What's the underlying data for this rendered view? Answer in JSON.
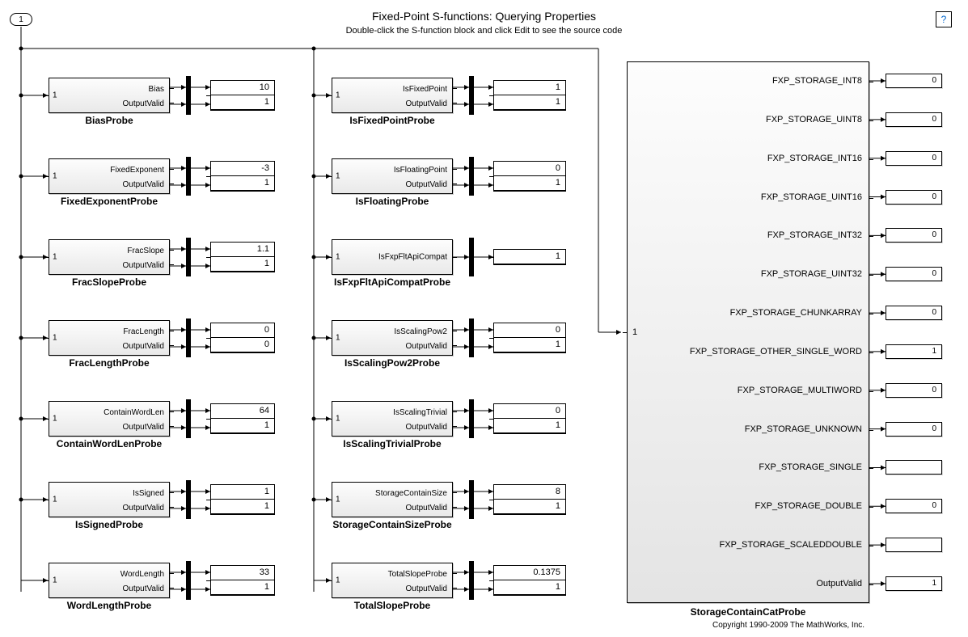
{
  "header": {
    "title": "Fixed-Point S-functions: Querying Properties",
    "subtitle": "Double-click the S-function block and click Edit to see the source code"
  },
  "inport": {
    "label": "1"
  },
  "help": {
    "label": "?"
  },
  "probes_col1": [
    {
      "name": "BiasProbe",
      "in": "1",
      "out1": "Bias",
      "out2": "OutputValid",
      "v1": "10",
      "v2": "1"
    },
    {
      "name": "FixedExponentProbe",
      "in": "1",
      "out1": "FixedExponent",
      "out2": "OutputValid",
      "v1": "-3",
      "v2": "1"
    },
    {
      "name": "FracSlopeProbe",
      "in": "1",
      "out1": "FracSlope",
      "out2": "OutputValid",
      "v1": "1.1",
      "v2": "1"
    },
    {
      "name": "FracLengthProbe",
      "in": "1",
      "out1": "FracLength",
      "out2": "OutputValid",
      "v1": "0",
      "v2": "0"
    },
    {
      "name": "ContainWordLenProbe",
      "in": "1",
      "out1": "ContainWordLen",
      "out2": "OutputValid",
      "v1": "64",
      "v2": "1"
    },
    {
      "name": "IsSignedProbe",
      "in": "1",
      "out1": "IsSigned",
      "out2": "OutputValid",
      "v1": "1",
      "v2": "1"
    },
    {
      "name": "WordLengthProbe",
      "in": "1",
      "out1": "WordLength",
      "out2": "OutputValid",
      "v1": "33",
      "v2": "1"
    }
  ],
  "probes_col2": [
    {
      "name": "IsFixedPointProbe",
      "in": "1",
      "out1": "IsFixedPoint",
      "out2": "OutputValid",
      "v1": "1",
      "v2": "1",
      "single": false
    },
    {
      "name": "IsFloatingProbe",
      "in": "1",
      "out1": "IsFloatingPoint",
      "out2": "OutputValid",
      "v1": "0",
      "v2": "1",
      "single": false
    },
    {
      "name": "IsFxpFltApiCompatProbe",
      "in": "1",
      "out1": "IsFxpFltApiCompat",
      "out2": "",
      "v1": "1",
      "v2": "",
      "single": true
    },
    {
      "name": "IsScalingPow2Probe",
      "in": "1",
      "out1": "IsScalingPow2",
      "out2": "OutputValid",
      "v1": "0",
      "v2": "1",
      "single": false
    },
    {
      "name": "IsScalingTrivialProbe",
      "in": "1",
      "out1": "IsScalingTrivial",
      "out2": "OutputValid",
      "v1": "0",
      "v2": "1",
      "single": false
    },
    {
      "name": "StorageContainSizeProbe",
      "in": "1",
      "out1": "StorageContainSize",
      "out2": "OutputValid",
      "v1": "8",
      "v2": "1",
      "single": false
    },
    {
      "name": "TotalSlopeProbe",
      "in": "1",
      "out1": "TotalSlopeProbe",
      "out2": "OutputValid",
      "v1": "0.1375",
      "v2": "1",
      "single": false
    }
  ],
  "big_probe": {
    "name": "StorageContainCatProbe",
    "in": "1",
    "outs": [
      {
        "label": "FXP_STORAGE_INT8",
        "v": "0"
      },
      {
        "label": "FXP_STORAGE_UINT8",
        "v": "0"
      },
      {
        "label": "FXP_STORAGE_INT16",
        "v": "0"
      },
      {
        "label": "FXP_STORAGE_UINT16",
        "v": "0"
      },
      {
        "label": "FXP_STORAGE_INT32",
        "v": "0"
      },
      {
        "label": "FXP_STORAGE_UINT32",
        "v": "0"
      },
      {
        "label": "FXP_STORAGE_CHUNKARRAY",
        "v": "0"
      },
      {
        "label": "FXP_STORAGE_OTHER_SINGLE_WORD",
        "v": "1"
      },
      {
        "label": "FXP_STORAGE_MULTIWORD",
        "v": "0"
      },
      {
        "label": "FXP_STORAGE_UNKNOWN",
        "v": "0"
      },
      {
        "label": "FXP_STORAGE_SINGLE",
        "v": ""
      },
      {
        "label": "FXP_STORAGE_DOUBLE",
        "v": "0"
      },
      {
        "label": "FXP_STORAGE_SCALEDDOUBLE",
        "v": ""
      },
      {
        "label": "OutputValid",
        "v": "1"
      }
    ]
  },
  "footer": {
    "copyright": "Copyright 1990-2009 The MathWorks, Inc."
  }
}
